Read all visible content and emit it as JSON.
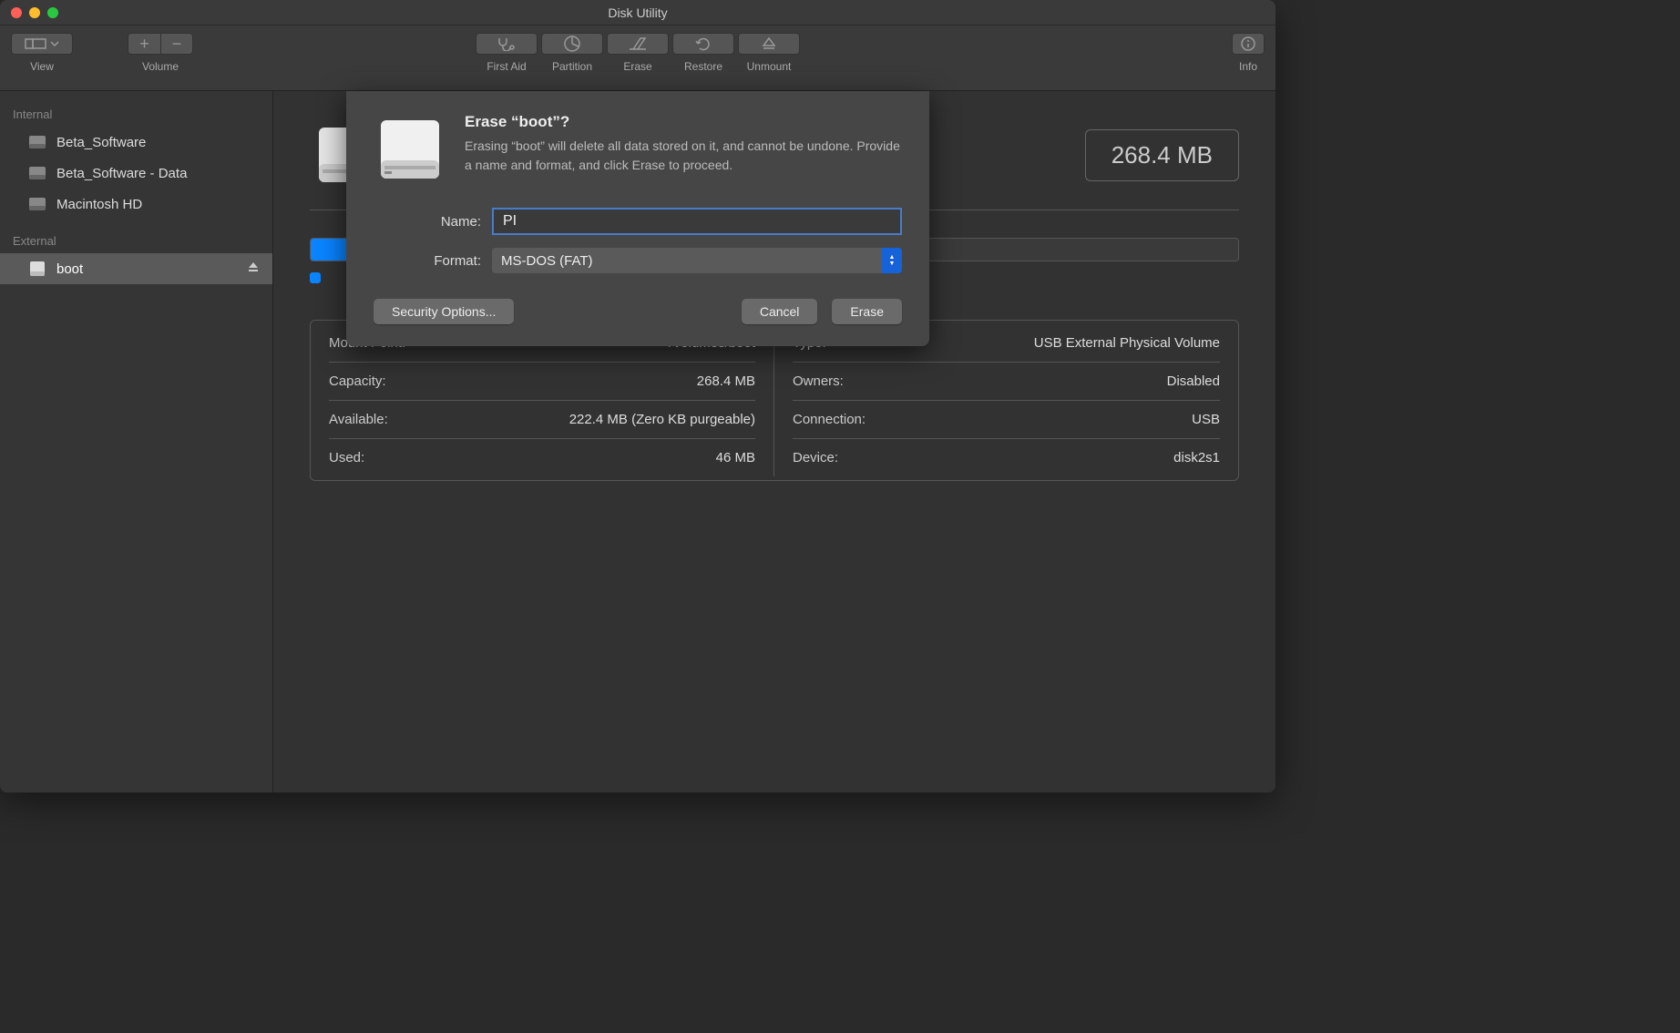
{
  "window": {
    "title": "Disk Utility"
  },
  "toolbar": {
    "view": "View",
    "volume": "Volume",
    "first_aid": "First Aid",
    "partition": "Partition",
    "erase": "Erase",
    "restore": "Restore",
    "unmount": "Unmount",
    "info": "Info"
  },
  "sidebar": {
    "internal_label": "Internal",
    "external_label": "External",
    "internal": [
      {
        "label": "Beta_Software"
      },
      {
        "label": "Beta_Software - Data"
      },
      {
        "label": "Macintosh HD"
      }
    ],
    "external": [
      {
        "label": "boot"
      }
    ]
  },
  "main": {
    "size": "268.4 MB"
  },
  "details": {
    "left": [
      {
        "label": "Mount Point:",
        "value": "/Volumes/boot"
      },
      {
        "label": "Capacity:",
        "value": "268.4 MB"
      },
      {
        "label": "Available:",
        "value": "222.4 MB (Zero KB purgeable)"
      },
      {
        "label": "Used:",
        "value": "46 MB"
      }
    ],
    "right": [
      {
        "label": "Type:",
        "value": "USB External Physical Volume"
      },
      {
        "label": "Owners:",
        "value": "Disabled"
      },
      {
        "label": "Connection:",
        "value": "USB"
      },
      {
        "label": "Device:",
        "value": "disk2s1"
      }
    ]
  },
  "dialog": {
    "title": "Erase “boot”?",
    "description": "Erasing “boot” will delete all data stored on it, and cannot be undone. Provide a name and format, and click Erase to proceed.",
    "name_label": "Name:",
    "name_value": "PI",
    "format_label": "Format:",
    "format_value": "MS-DOS (FAT)",
    "security_options": "Security Options...",
    "cancel": "Cancel",
    "erase": "Erase"
  }
}
